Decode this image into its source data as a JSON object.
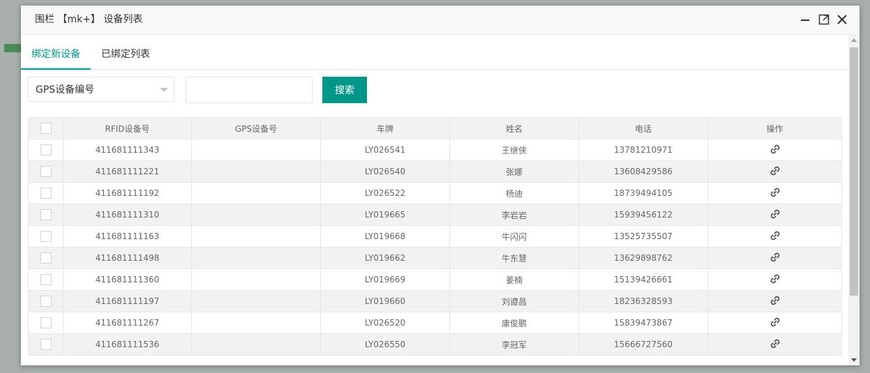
{
  "dialog": {
    "title": "围栏 【mk+】 设备列表"
  },
  "tabs": [
    {
      "label": "绑定新设备",
      "active": true
    },
    {
      "label": "已绑定列表",
      "active": false
    }
  ],
  "search": {
    "field_select": "GPS设备编号",
    "input_value": "",
    "button_label": "搜索"
  },
  "table": {
    "headers": [
      "RFID设备号",
      "GPS设备号",
      "车牌",
      "姓名",
      "电话",
      "操作"
    ],
    "rows": [
      {
        "rfid": "411681111343",
        "gps": "",
        "plate": "LY026541",
        "name": "王继侠",
        "phone": "13781210971"
      },
      {
        "rfid": "411681111221",
        "gps": "",
        "plate": "LY026540",
        "name": "张娜",
        "phone": "13608429586"
      },
      {
        "rfid": "411681111192",
        "gps": "",
        "plate": "LY026522",
        "name": "杨迪",
        "phone": "18739494105"
      },
      {
        "rfid": "411681111310",
        "gps": "",
        "plate": "LY019665",
        "name": "李岩岩",
        "phone": "15939456122"
      },
      {
        "rfid": "411681111163",
        "gps": "",
        "plate": "LY019668",
        "name": "牛闪闪",
        "phone": "13525735507"
      },
      {
        "rfid": "411681111498",
        "gps": "",
        "plate": "LY019662",
        "name": "牛东慧",
        "phone": "13629898762"
      },
      {
        "rfid": "411681111360",
        "gps": "",
        "plate": "LY019669",
        "name": "姜楠",
        "phone": "15139426661"
      },
      {
        "rfid": "411681111197",
        "gps": "",
        "plate": "LY019660",
        "name": "刘遵昌",
        "phone": "18236328593"
      },
      {
        "rfid": "411681111267",
        "gps": "",
        "plate": "LY026520",
        "name": "康俊鹏",
        "phone": "15839473867"
      },
      {
        "rfid": "411681111536",
        "gps": "",
        "plate": "LY026550",
        "name": "李冠军",
        "phone": "15666727560"
      }
    ]
  },
  "colors": {
    "accent": "#009688",
    "row_alt": "#f2f2f2",
    "border": "#e6e6e6"
  },
  "icons": {
    "row_action": "link-icon",
    "minimize": "minimize-icon",
    "maximize": "maximize-icon",
    "close": "close-icon"
  }
}
